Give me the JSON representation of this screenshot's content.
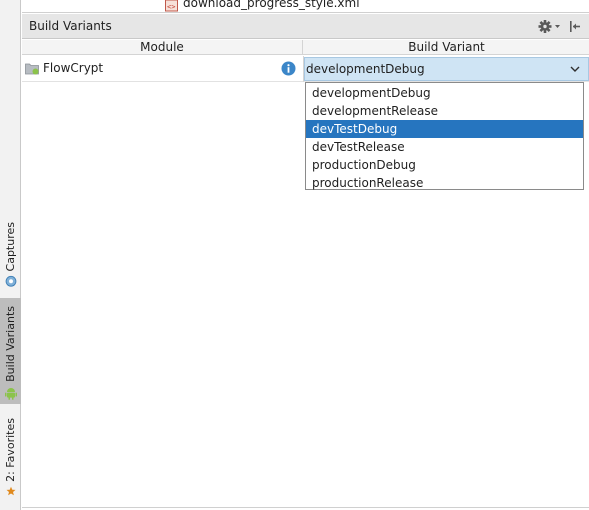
{
  "file_strip": {
    "filename": "download_progress_style.xml"
  },
  "panel": {
    "title": "Build Variants",
    "settings_icon": "gear-icon",
    "hide_icon": "pin-hide-icon"
  },
  "table": {
    "columns": [
      "Module",
      "Build Variant"
    ],
    "rows": [
      {
        "module": "FlowCrypt",
        "module_icon": "android-module-folder-icon",
        "has_info": true,
        "variant": "developmentDebug"
      }
    ]
  },
  "dropdown": {
    "options": [
      "developmentDebug",
      "developmentRelease",
      "devTestDebug",
      "devTestRelease",
      "productionDebug",
      "productionRelease"
    ],
    "highlighted": "devTestDebug"
  },
  "side_tabs": [
    {
      "label": "Captures",
      "icon": "captures-icon",
      "active": false
    },
    {
      "label": "Build Variants",
      "icon": "android-icon",
      "active": true
    },
    {
      "label": "2: Favorites",
      "icon": "star-icon",
      "active": false
    }
  ],
  "colors": {
    "selection": "#2675bf",
    "combo_background": "#cfe4f4",
    "active_tab": "#bdbdbd",
    "favorites_star": "#e08a1e",
    "android_green": "#8bc34a"
  }
}
